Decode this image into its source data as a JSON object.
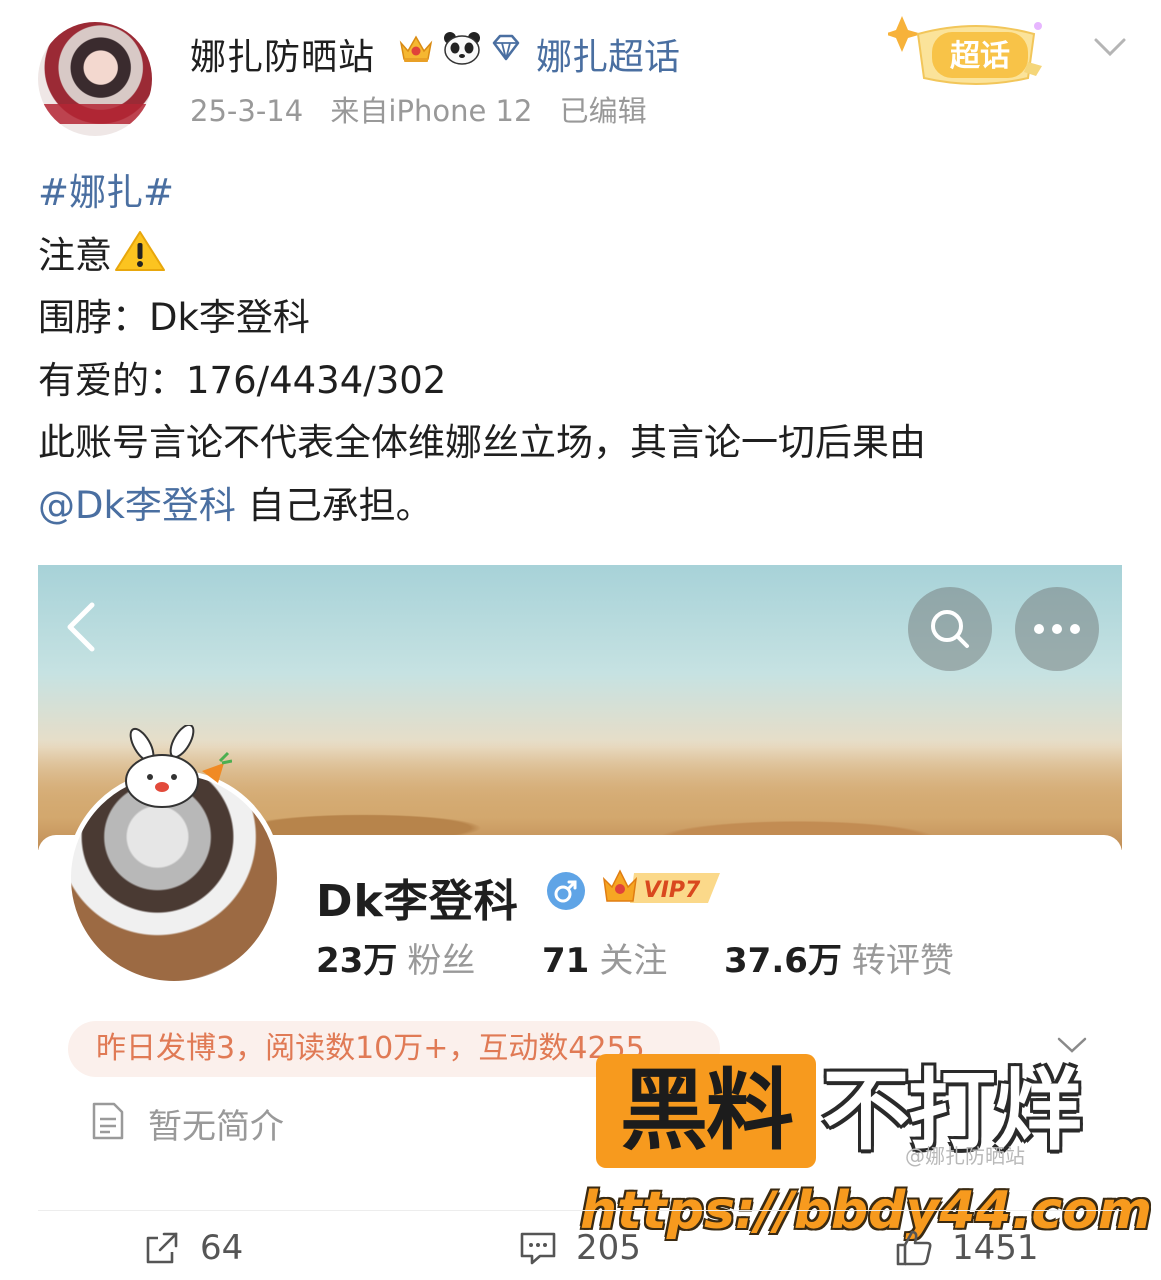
{
  "header": {
    "username": "娜扎防晒站",
    "super_topic_link": "娜扎超话",
    "date": "25-3-14",
    "source": "来自iPhone 12",
    "edited": "已编辑",
    "super_badge_label": "超话"
  },
  "post": {
    "hashtag": "#娜扎#",
    "attention": "注意",
    "scarf_line": "围脖：Dk李登科",
    "love_line": "有爱的：176/4434/302",
    "disclaimer_line1": "此账号言论不代表全体维娜丝立场，其言论一切后果由",
    "mention": "@Dk李登科",
    "disclaimer_end": " 自己承担。"
  },
  "profile_card": {
    "name": "Dk李登科",
    "vip_label": "VIP7",
    "fans_value": "23万",
    "fans_label": "粉丝",
    "follow_value": "71",
    "follow_label": "关注",
    "likes_value": "37.6万",
    "likes_label": "转评赞",
    "activity": "昨日发博3，阅读数10万+，互动数4255",
    "bio": "暂无简介"
  },
  "watermark": {
    "block_text": "黑料",
    "text": "不打烊",
    "small": "@娜扎防晒站",
    "url": "https://bbdy44.com"
  },
  "footer": {
    "reposts": "64",
    "comments": "205",
    "likes": "1451"
  },
  "colors": {
    "link": "#4a6fa1",
    "meta_gray": "#999999",
    "watermark_orange": "#f79a1e",
    "activity_text": "#e07a55"
  }
}
